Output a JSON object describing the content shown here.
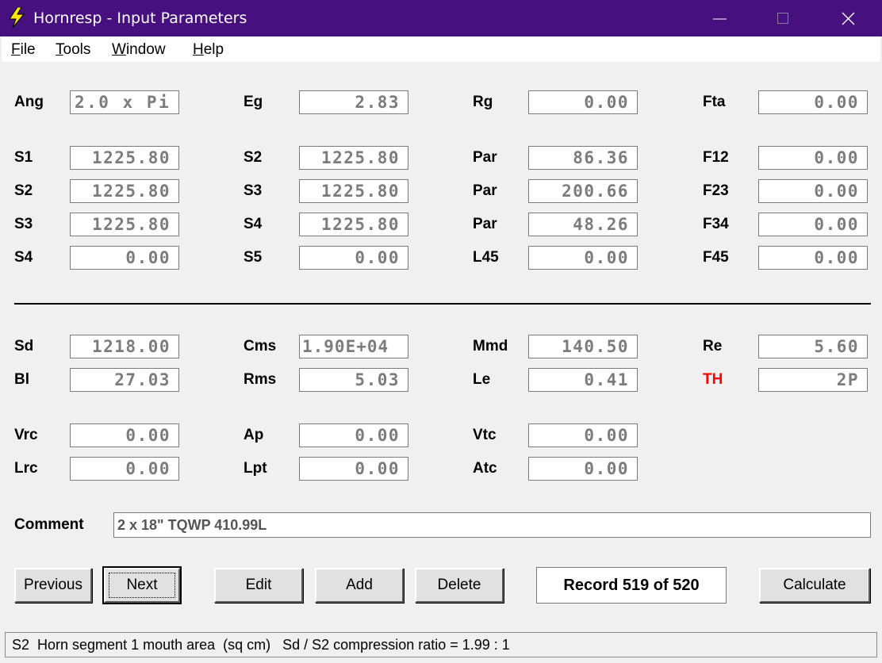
{
  "window": {
    "title": "Hornresp - Input Parameters"
  },
  "menu": [
    {
      "label": "File",
      "accel": "F"
    },
    {
      "label": "Tools",
      "accel": "T"
    },
    {
      "label": "Window",
      "accel": "W"
    },
    {
      "label": "Help",
      "accel": "H"
    }
  ],
  "params": {
    "Ang": {
      "label": "Ang",
      "value": "2.0 x Pi"
    },
    "Eg": {
      "label": "Eg",
      "value": "2.83"
    },
    "Rg": {
      "label": "Rg",
      "value": "0.00"
    },
    "Fta": {
      "label": "Fta",
      "value": "0.00"
    },
    "S1": {
      "label": "S1",
      "value": "1225.80"
    },
    "S2a": {
      "label": "S2",
      "value": "1225.80"
    },
    "Par1": {
      "label": "Par",
      "value": "86.36"
    },
    "F12": {
      "label": "F12",
      "value": "0.00"
    },
    "S2b": {
      "label": "S2",
      "value": "1225.80"
    },
    "S3a": {
      "label": "S3",
      "value": "1225.80"
    },
    "Par2": {
      "label": "Par",
      "value": "200.66"
    },
    "F23": {
      "label": "F23",
      "value": "0.00"
    },
    "S3b": {
      "label": "S3",
      "value": "1225.80"
    },
    "S4a": {
      "label": "S4",
      "value": "1225.80"
    },
    "Par3": {
      "label": "Par",
      "value": "48.26"
    },
    "F34": {
      "label": "F34",
      "value": "0.00"
    },
    "S4b": {
      "label": "S4",
      "value": "0.00"
    },
    "S5": {
      "label": "S5",
      "value": "0.00"
    },
    "L45": {
      "label": "L45",
      "value": "0.00"
    },
    "F45": {
      "label": "F45",
      "value": "0.00"
    },
    "Sd": {
      "label": "Sd",
      "value": "1218.00"
    },
    "Cms": {
      "label": "Cms",
      "value": "1.90E+04"
    },
    "Mmd": {
      "label": "Mmd",
      "value": "140.50"
    },
    "Re": {
      "label": "Re",
      "value": "5.60"
    },
    "Bl": {
      "label": "Bl",
      "value": "27.03"
    },
    "Rms": {
      "label": "Rms",
      "value": "5.03"
    },
    "Le": {
      "label": "Le",
      "value": "0.41"
    },
    "TH": {
      "label": "TH",
      "value": "2P"
    },
    "Vrc": {
      "label": "Vrc",
      "value": "0.00"
    },
    "Ap": {
      "label": "Ap",
      "value": "0.00"
    },
    "Vtc": {
      "label": "Vtc",
      "value": "0.00"
    },
    "Lrc": {
      "label": "Lrc",
      "value": "0.00"
    },
    "Lpt": {
      "label": "Lpt",
      "value": "0.00"
    },
    "Atc": {
      "label": "Atc",
      "value": "0.00"
    }
  },
  "comment": {
    "label": "Comment",
    "value": "2 x 18\" TQWP 410.99L"
  },
  "buttons": {
    "previous": "Previous",
    "next": "Next",
    "edit": "Edit",
    "add": "Add",
    "delete": "Delete",
    "calculate": "Calculate"
  },
  "record": "Record 519 of 520",
  "status": "S2  Horn segment 1 mouth area  (sq cm)   Sd / S2 compression ratio = 1.99 : 1",
  "colors": {
    "titlebar": "#46107e",
    "th_label": "#ff0000",
    "field_text": "#7c7c7c"
  }
}
